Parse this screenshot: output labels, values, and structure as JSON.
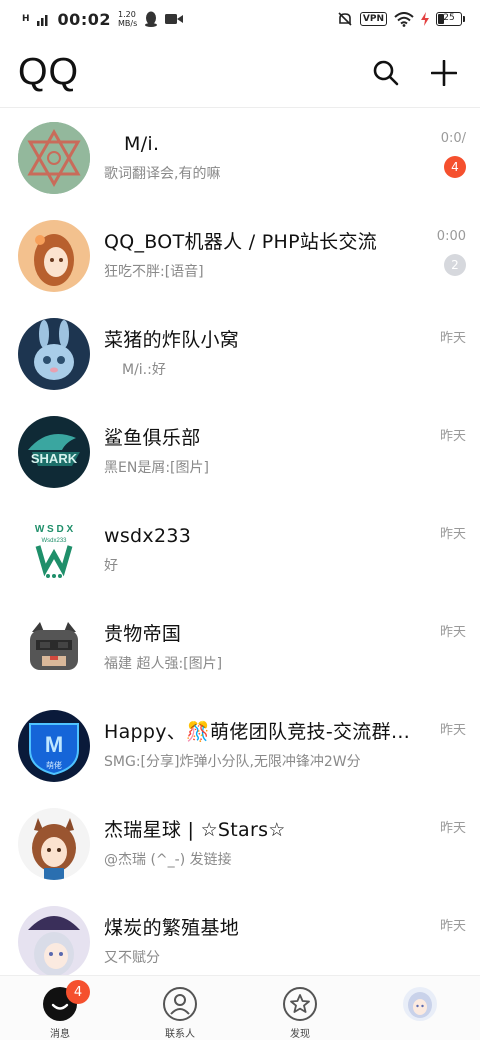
{
  "status_bar": {
    "network": "H",
    "time": "00:02",
    "speed_value": "1.20",
    "speed_unit": "MB/s",
    "vpn": "VPN",
    "battery": "25"
  },
  "header": {
    "title": "QQ",
    "search_icon": "search-icon",
    "add_icon": "plus-icon"
  },
  "chats": [
    {
      "name": "M/i.",
      "message": "歌词翻译会,有的嘛",
      "time": "0:0/",
      "badge": "4",
      "badge_muted": false
    },
    {
      "name": "QQ_BOT机器人 / PHP站长交流",
      "message": "狂吃不胖:[语音]",
      "time": "0:00",
      "badge": "2",
      "badge_muted": true
    },
    {
      "name": "菜猪的炸队小窝",
      "message": "M/i.:好",
      "time": "昨天",
      "badge": "",
      "badge_muted": false
    },
    {
      "name": "鲨鱼俱乐部",
      "message": "黑EN是屑:[图片]",
      "time": "昨天",
      "badge": "",
      "badge_muted": false
    },
    {
      "name": "wsdx233",
      "message": "好",
      "time": "昨天",
      "badge": "",
      "badge_muted": false
    },
    {
      "name": "贵物帝国",
      "message": "福建 超人强:[图片]",
      "time": "昨天",
      "badge": "",
      "badge_muted": false
    },
    {
      "name": "Happy、🎊萌佬团队竞技-交流群…",
      "message": "SMG:[分享]炸弹小分队,无限冲锋冲2W分",
      "time": "昨天",
      "badge": "",
      "badge_muted": false
    },
    {
      "name": "杰瑞星球 | ☆Stars☆",
      "message": "@杰瑞 (^_-) 发链接",
      "time": "昨天",
      "badge": "",
      "badge_muted": false
    },
    {
      "name": "煤炭的繁殖基地",
      "message": "又不赋分",
      "time": "昨天",
      "badge": "",
      "badge_muted": false
    }
  ],
  "avatar_logos": {
    "shark": "SHARK",
    "wsdx_letters": "W S D X",
    "wsdx_sub": "Wsdx233",
    "happy_letter": "M",
    "happy_sub": "萌佬"
  },
  "tabbar": {
    "messages": "消息",
    "messages_badge": "4",
    "contacts": "联系人",
    "discover": "发现"
  },
  "colors": {
    "badge": "#f5502e",
    "badge_muted": "#d6d8dd",
    "time": "#9a9a9a"
  }
}
